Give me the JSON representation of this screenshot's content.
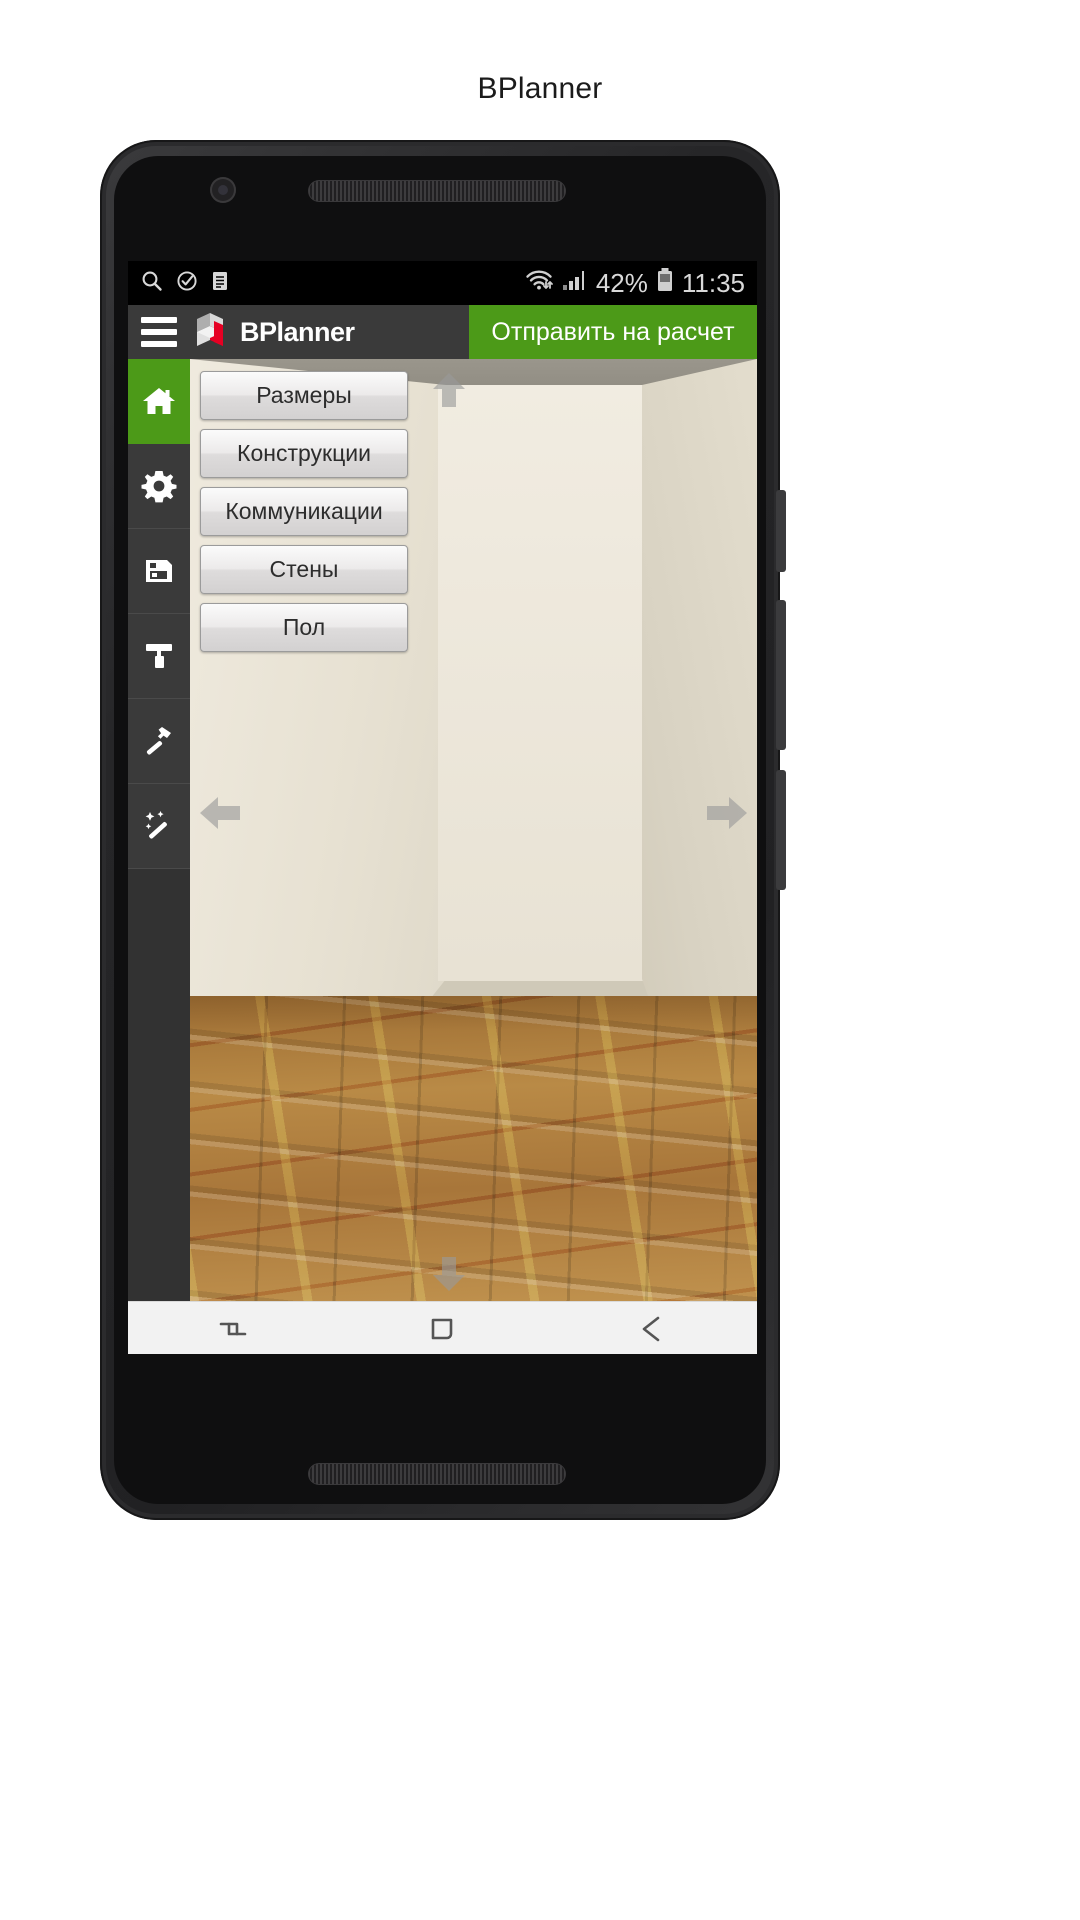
{
  "page": {
    "caption": "BPlanner"
  },
  "statusbar": {
    "left_icons": [
      "search-icon",
      "check-circle-icon",
      "document-icon"
    ],
    "wifi_icon": "wifi-icon",
    "signal_icon": "cellular-signal-icon",
    "battery_percent": "42%",
    "battery_icon": "battery-icon",
    "time": "11:35"
  },
  "actionbar": {
    "menu_icon": "hamburger-menu-icon",
    "logo_icon": "bplanner-logo-icon",
    "brand": "BPlanner",
    "send_label": "Отправить на расчет",
    "send_color": "#4c9a18",
    "bar_color": "#3a3a3a"
  },
  "rail": {
    "items": [
      {
        "name": "home",
        "icon": "home-icon",
        "active": true
      },
      {
        "name": "settings",
        "icon": "gear-icon",
        "active": false
      },
      {
        "name": "save",
        "icon": "floppy-disk-icon",
        "active": false
      },
      {
        "name": "finishing",
        "icon": "paint-roller-icon",
        "active": false
      },
      {
        "name": "build",
        "icon": "hammer-icon",
        "active": false
      },
      {
        "name": "magic",
        "icon": "magic-wand-icon",
        "active": false
      }
    ],
    "active_color": "#4c9a18"
  },
  "panel": {
    "buttons": [
      "Размеры",
      "Конструкции",
      "Коммуникации",
      "Стены",
      "Пол"
    ]
  },
  "viewport": {
    "arrows": [
      "arrow-up",
      "arrow-down",
      "arrow-left",
      "arrow-right"
    ],
    "scene": "3d-room-preview"
  },
  "navbar": {
    "items": [
      "recents-icon",
      "home-square-icon",
      "back-arrow-icon"
    ]
  }
}
